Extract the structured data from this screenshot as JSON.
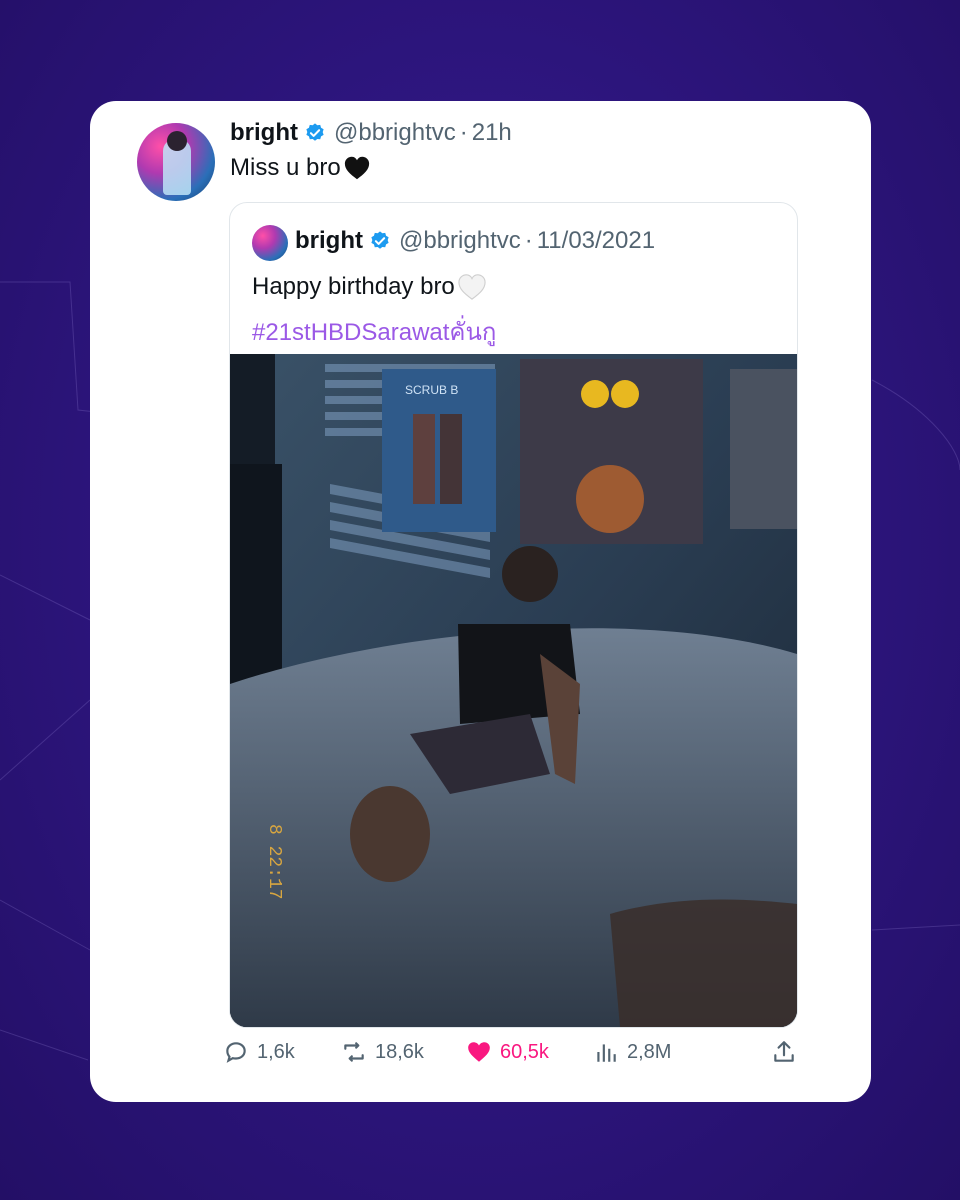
{
  "tweet": {
    "author_name": "bright",
    "handle": "@bbrightvc",
    "separator": "·",
    "time": "21h",
    "text": "Miss u bro",
    "avatar_icon": "profile-avatar",
    "verified_icon": "verified-badge-icon",
    "emoji": "black-heart"
  },
  "quoted": {
    "author_name": "bright",
    "handle": "@bbrightvc",
    "separator": "·",
    "date": "11/03/2021",
    "text": "Happy birthday bro",
    "hashtag": "#21stHBDSarawatคั่นกู",
    "emoji": "white-heart",
    "photo": {
      "poster_label": "SCRUB B",
      "timestamp": "8 22:17"
    }
  },
  "actions": {
    "reply_count": "1,6k",
    "retweet_count": "18,6k",
    "like_count": "60,5k",
    "views_count": "2,8M"
  },
  "colors": {
    "background": "#2e1680",
    "accent": "#1d9bf0",
    "hashtag": "#9b59e6",
    "like": "#f91880",
    "muted": "#536471"
  }
}
